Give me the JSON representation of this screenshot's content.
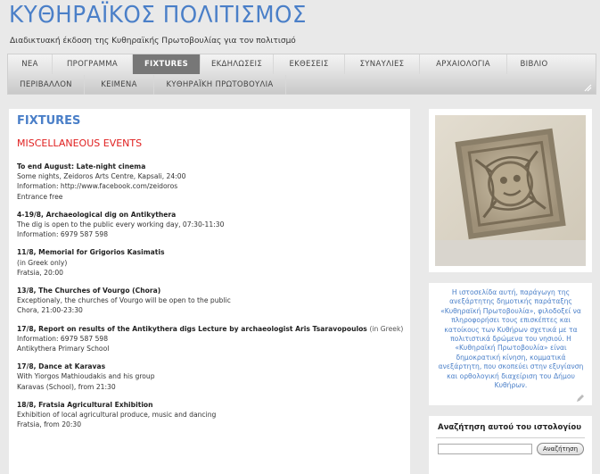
{
  "header": {
    "title": "ΚΥΘΗΡΑΪΚΟΣ ΠΟΛΙΤΙΣΜΟΣ",
    "tagline": "Διαδικτυακή έκδοση της Κυθηραϊκής Πρωτοβουλίας για τον πολιτισμό"
  },
  "nav": {
    "row1": [
      "ΝΕΑ",
      "ΠΡΟΓΡΑΜΜΑ",
      "FIXTURES",
      "ΕΚΔΗΛΩΣΕΙΣ",
      "ΕΚΘΕΣΕΙΣ",
      "ΣΥΝΑΥΛΙΕΣ",
      "ΑΡΧΑΙΟΛΟΓΙΑ",
      "ΒΙΒΛΙΟ"
    ],
    "row2": [
      "ΠΕΡΙΒΑΛΛΟΝ",
      "ΚΕΙΜΕΝΑ",
      "ΚΥΘΗΡΑΪΚΗ ΠΡΩΤΟΒΟΥΛΙΑ"
    ],
    "active": "FIXTURES"
  },
  "post": {
    "title": "FIXTURES",
    "section_heading": "MISCELLANEOUS EVENTS",
    "events": [
      {
        "title": "To end August: Late-night cinema",
        "lines": [
          "Some nights, Zeidoros Arts Centre, Kapsali, 24:00",
          "Information: http://www.facebook.com/zeidoros",
          "Entrance free"
        ]
      },
      {
        "title": "4-19/8, Archaeological dig on Antikythera",
        "lines": [
          "The dig is open to the public every working day, 07:30-11:30",
          "Information: 6979 587 598"
        ]
      },
      {
        "title": "11/8, Memorial for Grigorios Kasimatis",
        "lines": [
          "(in Greek only)",
          "Fratsia, 20:00"
        ]
      },
      {
        "title": "13/8, The Churches of Vourgo (Chora)",
        "lines": [
          "Exceptionaly, the churches of Vourgo will be open to the public",
          "Chora, 21:00-23:30"
        ]
      },
      {
        "title": "17/8, Report on results of the Antikythera digs Lecture by archaeologist Aris Tsaravopoulos",
        "title_note": "(in Greek)",
        "lines": [
          "Information: 6979 587 598",
          "Antikythera Primary School"
        ]
      },
      {
        "title": "17/8, Dance at Karavas",
        "lines": [
          "With Yiorgos Mathioudakis and his group",
          "Karavas (School), from 21:30"
        ]
      },
      {
        "title": " 18/8, Fratsia Agricultural Exhibition",
        "lines": [
          "Exhibition of local agricultural produce, music and dancing",
          "Fratsia, from 20:30"
        ]
      }
    ]
  },
  "sidebar": {
    "about_text": "Η ιστοσελίδα αυτή, παράγωγη της ανεξάρτητης δημοτικής παράταξης «Κυθηραϊκή Πρωτοβουλία», φιλοδοξεί να πληροφορήσει τους επισκέπτες και κατοίκους των Κυθήρων σχετικά με τα πολιτιστικά δρώμενα του νησιού. Η «Κυθηραϊκή Πρωτοβουλία» είναι δημοκρατική κίνηση, κομματικά ανεξάρτητη, που σκοπεύει στην εξυγίανση και ορθολογική διαχείριση του Δήμου Κυθήρων.",
    "search_title": "Αναζήτηση αυτού του ιστολογίου",
    "search_placeholder": "",
    "search_button": "Αναζήτηση"
  },
  "colors": {
    "title_blue": "#4a7fc8",
    "heading_red": "#e02020",
    "nav_active": "#777777",
    "page_bg": "#e9e9e9"
  }
}
